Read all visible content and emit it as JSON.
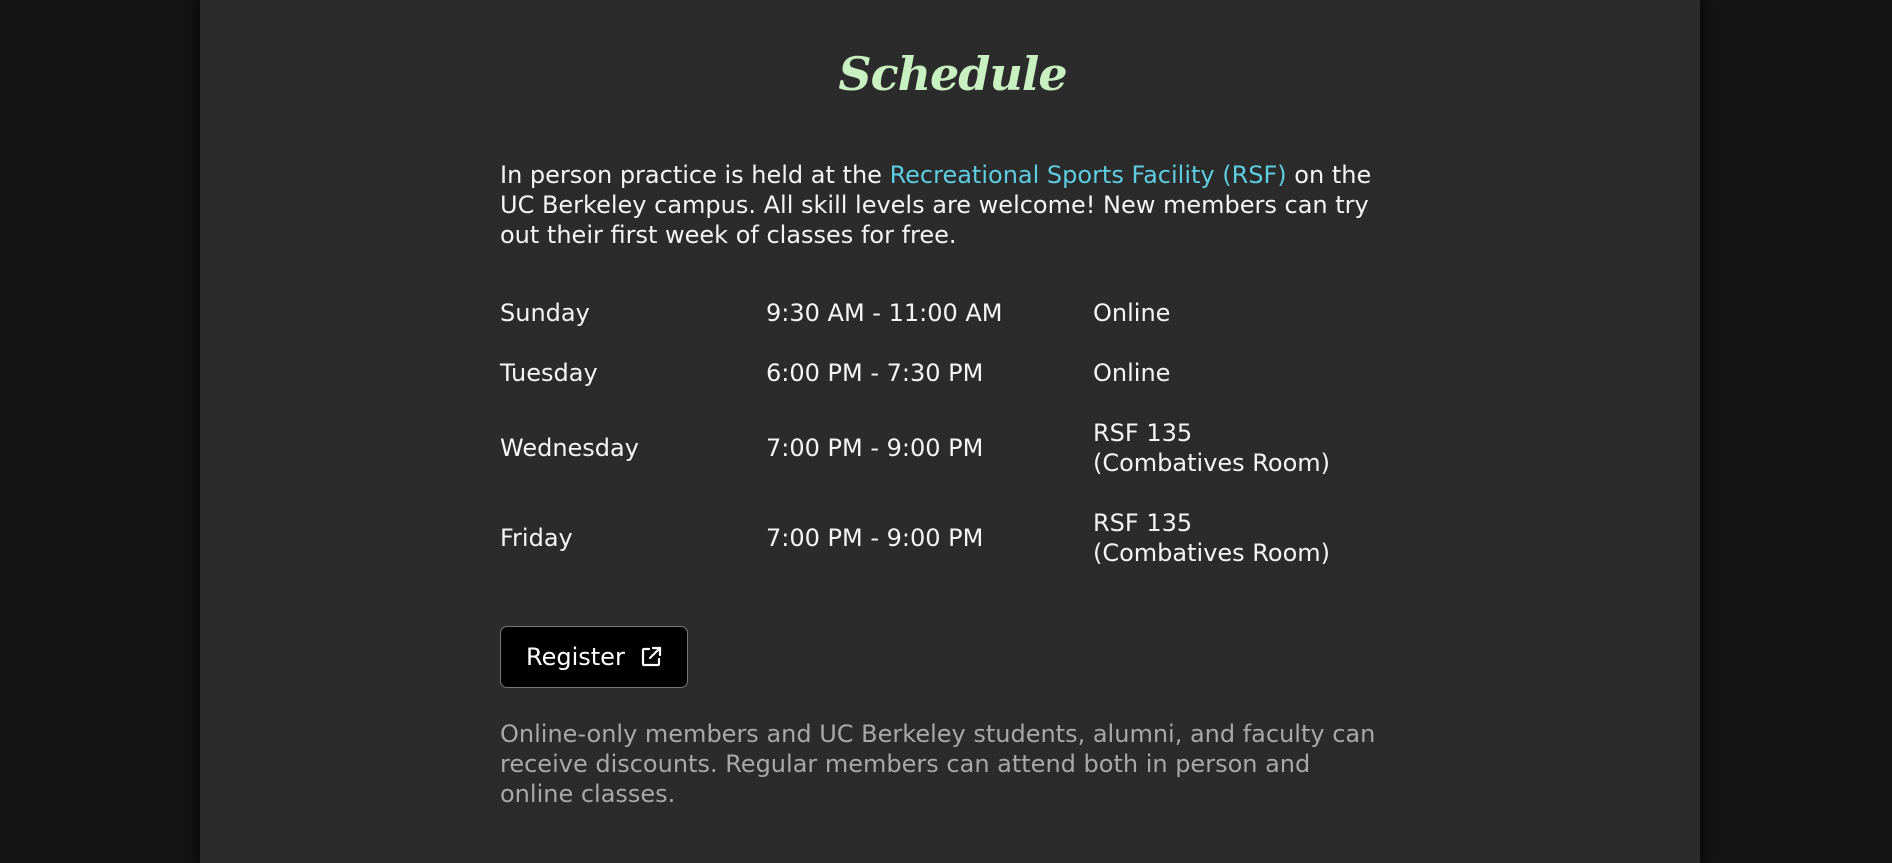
{
  "schedule": {
    "title": "Schedule",
    "intro": {
      "before_link": "In person practice is held at the ",
      "link_text": "Recreational Sports Facility (RSF)",
      "after_link": " on the UC Berkeley campus. All skill levels are welcome! New members can try out their first week of classes for free."
    },
    "rows": [
      {
        "day": "Sunday",
        "time": "9:30 AM - 11:00 AM",
        "location_line1": "Online",
        "location_line2": ""
      },
      {
        "day": "Tuesday",
        "time": "6:00 PM - 7:30 PM",
        "location_line1": "Online",
        "location_line2": ""
      },
      {
        "day": "Wednesday",
        "time": "7:00 PM - 9:00 PM",
        "location_line1": "RSF 135",
        "location_line2": "(Combatives Room)"
      },
      {
        "day": "Friday",
        "time": "7:00 PM - 9:00 PM",
        "location_line1": "RSF 135",
        "location_line2": "(Combatives Room)"
      }
    ],
    "register_label": "Register",
    "register_icon": "external-link-icon",
    "note": "Online-only members and UC Berkeley students, alumni, and faculty can receive discounts. Regular members can attend both in person and online classes."
  },
  "colors": {
    "background_outer": "#141414",
    "background_page": "#2b2b2b",
    "title": "#c8f0c0",
    "link": "#5ecde0",
    "text": "#f4f4f4",
    "muted_text": "#a8a8a8",
    "button_bg": "#000000"
  }
}
